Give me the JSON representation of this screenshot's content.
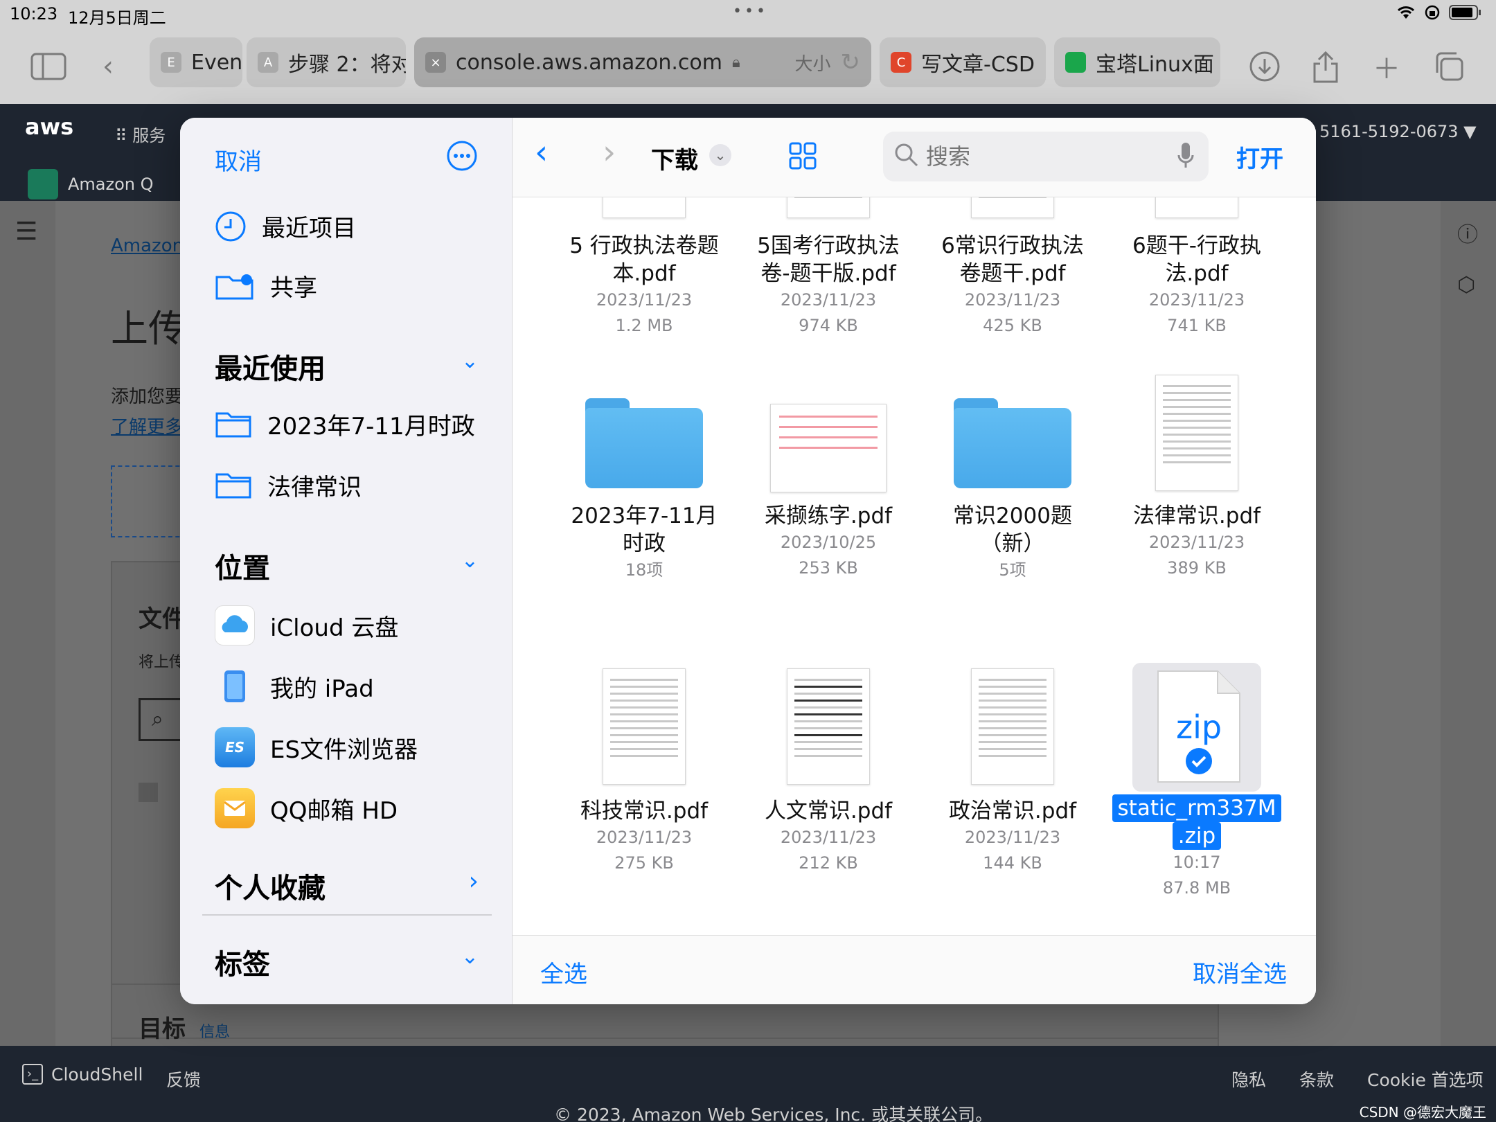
{
  "status": {
    "time": "10:23",
    "date": "12月5日周二",
    "dots": "•••"
  },
  "tabs": [
    {
      "letter": "E",
      "title": "Even"
    },
    {
      "letter": "A",
      "title": "步骤 2：将对"
    },
    {
      "letter": "×",
      "title": "console.aws.amazon.com",
      "extra": "大小"
    },
    {
      "letter": "C",
      "title": "写文章-CSD"
    },
    {
      "letter": "",
      "title": "宝塔Linux面"
    }
  ],
  "aws": {
    "logo": "aws",
    "services": "服务",
    "account": "5161-5192-0673 ▼",
    "amazon_q": "Amazon Q",
    "breadcrumb": "Amazon",
    "heading": "上传",
    "desc": "添加您要",
    "learn_more": "了解更多",
    "files_title": "文件",
    "files_desc": "将上传",
    "target": "目标",
    "target_info": "信息"
  },
  "footer": {
    "cloudshell": "CloudShell",
    "feedback": "反馈",
    "privacy": "隐私",
    "terms": "条款",
    "cookie": "Cookie 首选项",
    "copyright": "© 2023, Amazon Web Services, Inc. 或其关联公司。",
    "watermark": "CSDN @德宏大魔王"
  },
  "dialog": {
    "cancel": "取消",
    "open": "打开",
    "folder": "下载",
    "search_placeholder": "搜索",
    "select_all": "全选",
    "deselect_all": "取消全选",
    "sidebar": {
      "recents": "最近项目",
      "shared": "共享",
      "recent_used": "最近使用",
      "recent_folders": [
        "2023年7-11月时政",
        "法律常识"
      ],
      "locations": "位置",
      "location_items": [
        "iCloud 云盘",
        "我的 iPad",
        "ES文件浏览器",
        "QQ邮箱 HD"
      ],
      "favorites": "个人收藏",
      "tags": "标签"
    },
    "files": [
      {
        "name": [
          "5 行政执法卷题",
          "本.pdf"
        ],
        "date": "2023/11/23",
        "size": "1.2 MB"
      },
      {
        "name": [
          "5国考行政执法",
          "卷-题干版.pdf"
        ],
        "date": "2023/11/23",
        "size": "974 KB"
      },
      {
        "name": [
          "6常识行政执法",
          "卷题干.pdf"
        ],
        "date": "2023/11/23",
        "size": "425 KB"
      },
      {
        "name": [
          "6题干-行政执",
          "法.pdf"
        ],
        "date": "2023/11/23",
        "size": "741 KB"
      },
      {
        "name": [
          "2023年7-11月",
          "时政"
        ],
        "date": "18项",
        "size": ""
      },
      {
        "name": [
          "采撷练字.pdf"
        ],
        "date": "2023/10/25",
        "size": "253 KB"
      },
      {
        "name": [
          "常识2000题",
          "（新）"
        ],
        "date": "5项",
        "size": ""
      },
      {
        "name": [
          "法律常识.pdf"
        ],
        "date": "2023/11/23",
        "size": "389 KB"
      },
      {
        "name": [
          "科技常识.pdf"
        ],
        "date": "2023/11/23",
        "size": "275 KB"
      },
      {
        "name": [
          "人文常识.pdf"
        ],
        "date": "2023/11/23",
        "size": "212 KB"
      },
      {
        "name": [
          "政治常识.pdf"
        ],
        "date": "2023/11/23",
        "size": "144 KB"
      },
      {
        "name": [
          "static_rm337M",
          ".zip"
        ],
        "date": "10:17",
        "size": "87.8 MB"
      }
    ],
    "zip_label": "zip"
  }
}
